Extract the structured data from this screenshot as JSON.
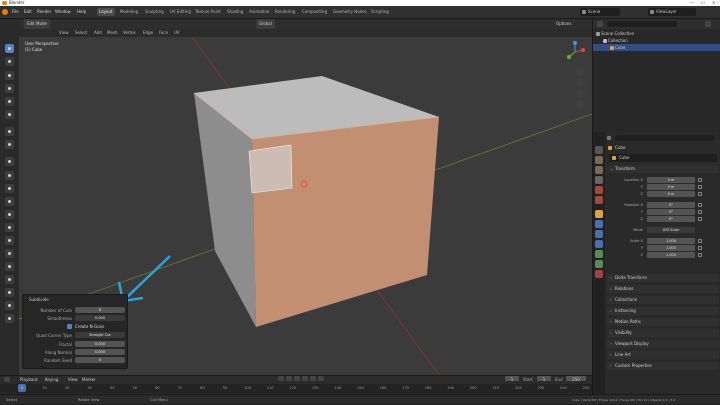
{
  "window": {
    "title": "Blender",
    "controls": [
      "—",
      "☐",
      "✕"
    ]
  },
  "menu": [
    "File",
    "Edit",
    "Render",
    "Window",
    "Help"
  ],
  "workspaces": [
    {
      "label": "Layout",
      "active": true
    },
    {
      "label": "Modeling",
      "active": false
    },
    {
      "label": "Sculpting",
      "active": false
    },
    {
      "label": "UV Editing",
      "active": false
    },
    {
      "label": "Texture Paint",
      "active": false
    },
    {
      "label": "Shading",
      "active": false
    },
    {
      "label": "Animation",
      "active": false
    },
    {
      "label": "Rendering",
      "active": false
    },
    {
      "label": "Compositing",
      "active": false
    },
    {
      "label": "Geometry Nodes",
      "active": false
    },
    {
      "label": "Scripting",
      "active": false
    }
  ],
  "scene": {
    "label": "Scene",
    "view_layer": "ViewLayer"
  },
  "viewport": {
    "mode": "Edit Mode",
    "header_items": [
      "View",
      "Select",
      "Add",
      "Mesh",
      "Vertex",
      "Edge",
      "Face",
      "UV"
    ],
    "transform_orientation": "Global",
    "overlay_title": "User Perspective",
    "overlay_object": "(1) Cube",
    "options_label": "Options"
  },
  "operator_panel": {
    "title": "Subdivide",
    "rows": [
      {
        "label": "Number of Cuts",
        "value": "6"
      },
      {
        "label": "Smoothness",
        "value": "0.000"
      },
      {
        "label": "",
        "value": "Create N-Gons",
        "checkbox": true
      },
      {
        "label": "Quad Corner Type",
        "value": "Straight Cut"
      },
      {
        "label": "Fractal",
        "value": "0.000"
      },
      {
        "label": "Along Normal",
        "value": "0.000"
      },
      {
        "label": "Random Seed",
        "value": "0"
      }
    ]
  },
  "timeline": {
    "header": [
      "Playback",
      "Keying",
      "View",
      "Marker"
    ],
    "current_frame": "1",
    "start_label": "Start",
    "start": "1",
    "end_label": "End",
    "end": "250",
    "ticks": [
      "0",
      "10",
      "20",
      "30",
      "40",
      "50",
      "60",
      "70",
      "80",
      "90",
      "100",
      "110",
      "120",
      "130",
      "140",
      "150",
      "160",
      "170",
      "180",
      "190",
      "200",
      "210",
      "220",
      "230",
      "240",
      "250"
    ]
  },
  "status": {
    "left": "Select",
    "middle1": "Rotate View",
    "middle2": "Call Menu",
    "right": "Cube | Verts 8/8 | Edges 12/12 | Faces 6/6 | Tris 12 | Objects 1/1 | 3.0"
  },
  "outliner": {
    "rows": [
      {
        "label": "Scene Collection",
        "indent": 0,
        "selected": false
      },
      {
        "label": "Collection",
        "indent": 1,
        "selected": false
      },
      {
        "label": "Cube",
        "indent": 2,
        "selected": true
      }
    ]
  },
  "properties": {
    "object_name": "Cube",
    "data_name": "Cube",
    "transform_title": "Transform",
    "location": [
      {
        "label": "Location X",
        "value": "0 m"
      },
      {
        "label": "Y",
        "value": "0 m"
      },
      {
        "label": "Z",
        "value": "0 m"
      }
    ],
    "rotation": [
      {
        "label": "Rotation X",
        "value": "0°"
      },
      {
        "label": "Y",
        "value": "0°"
      },
      {
        "label": "Z",
        "value": "0°"
      }
    ],
    "mode_label": "Mode",
    "mode_value": "XYZ Euler",
    "scale": [
      {
        "label": "Scale X",
        "value": "1.000"
      },
      {
        "label": "Y",
        "value": "1.000"
      },
      {
        "label": "Z",
        "value": "1.000"
      }
    ],
    "sections": [
      "Delta Transform",
      "Relations",
      "Collections",
      "Instancing",
      "Motion Paths",
      "Visibility",
      "Viewport Display",
      "Line Art",
      "Custom Properties"
    ]
  }
}
